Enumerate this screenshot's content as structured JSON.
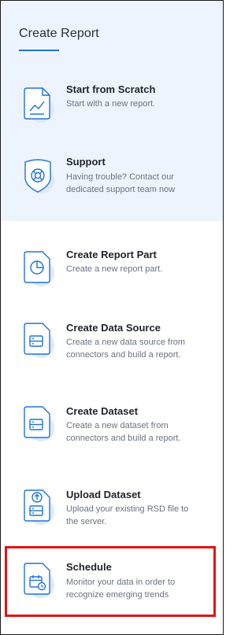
{
  "panel": {
    "title": "Create Report"
  },
  "items": [
    {
      "title": "Start from Scratch",
      "desc": "Start with a new report.",
      "icon": "chart-doc-icon"
    },
    {
      "title": "Support",
      "desc": "Having trouble? Contact our dedicated support team now",
      "icon": "lifebuoy-shield-icon"
    },
    {
      "title": "Create Report Part",
      "desc": "Create a new report part.",
      "icon": "pie-chart-doc-icon"
    },
    {
      "title": "Create Data Source",
      "desc": "Create a new data source from connectors and build a report.",
      "icon": "data-source-doc-icon"
    },
    {
      "title": "Create Dataset",
      "desc": "Create a new dataset from connectors and build a report.",
      "icon": "dataset-doc-icon"
    },
    {
      "title": "Upload Dataset",
      "desc": "Upload your existing RSD file to the server.",
      "icon": "upload-doc-icon"
    },
    {
      "title": "Schedule",
      "desc": "Monitor your data in order to recognize emerging trends",
      "icon": "calendar-doc-icon"
    }
  ],
  "colors": {
    "accent": "#1f73d8",
    "highlight": "#e41313",
    "top_bg": "#eef4fd"
  }
}
